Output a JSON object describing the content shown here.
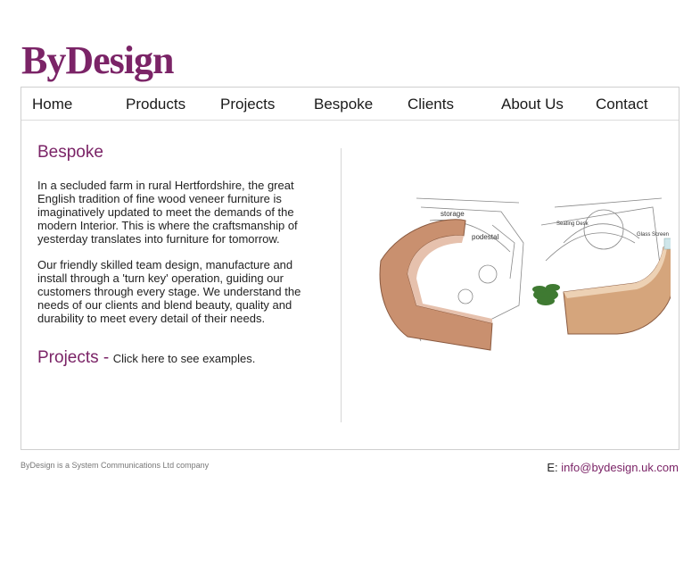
{
  "brand": {
    "logo_text": "ByDesign",
    "accent_color": "#7b2467"
  },
  "nav": {
    "items": [
      {
        "label": "Home"
      },
      {
        "label": "Products"
      },
      {
        "label": "Projects"
      },
      {
        "label": "Bespoke"
      },
      {
        "label": "Clients"
      },
      {
        "label": "About Us"
      },
      {
        "label": "Contact"
      }
    ]
  },
  "content": {
    "heading": "Bespoke",
    "paragraphs": [
      "In a secluded farm in rural Hertfordshire, the great English tradition of fine wood veneer furniture is imaginatively updated to meet the demands of the modern Interior. This is where the craftsmanship of yesterday translates into furniture for tomorrow.",
      "Our friendly skilled team design, manufacture and install through a 'turn key' operation, guiding our customers through every stage. We understand the needs of our clients and blend beauty, quality and durability to meet every detail of their needs."
    ],
    "projects_title": "Projects -",
    "projects_link": "Click here to see examples."
  },
  "illustration": {
    "labels": [
      "storage",
      "podestal",
      "Seating Desk",
      "Glass Screen"
    ]
  },
  "footer": {
    "note": "ByDesign is a System Communications Ltd company",
    "email_prefix": "E:",
    "email": "info@bydesign.uk.com"
  }
}
